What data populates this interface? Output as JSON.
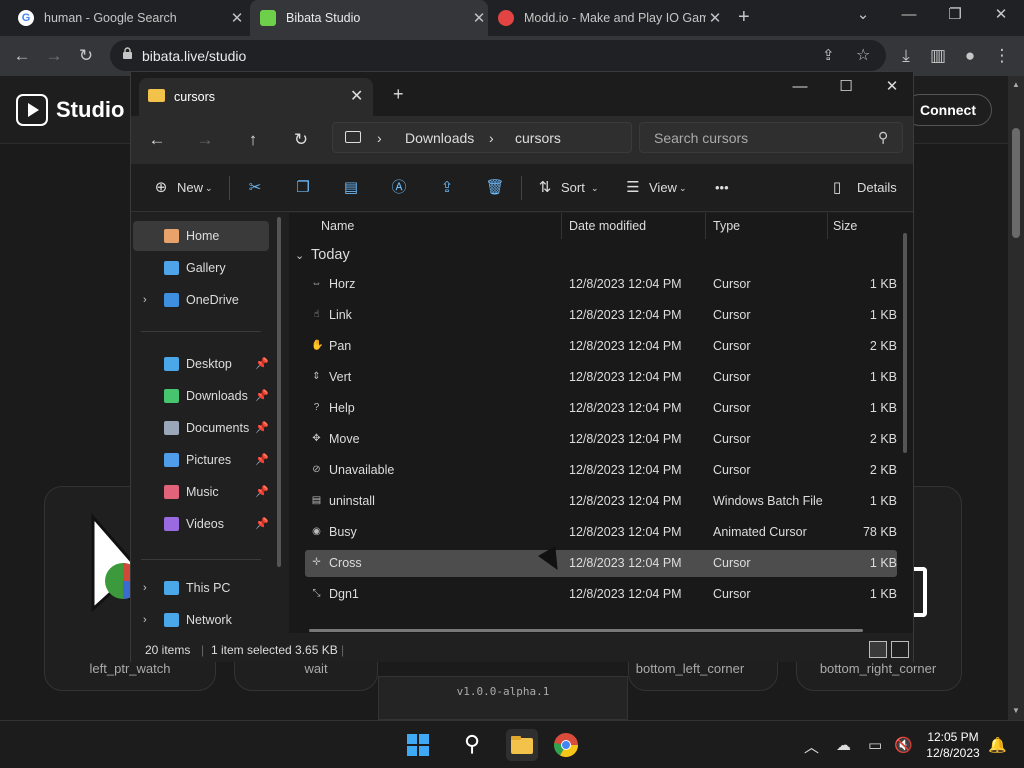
{
  "browser": {
    "tabs": [
      {
        "title": "human - Google Search",
        "favicon_color": "#ffffff"
      },
      {
        "title": "Bibata Studio",
        "favicon_color": "#6dcf4a"
      },
      {
        "title": "Modd.io - Make and Play IO Gam",
        "favicon_color": "#e24444"
      }
    ],
    "new_tab": "+",
    "url": "bibata.live/studio",
    "window_controls": {
      "min": "⌄",
      "minimize": "—",
      "restore": "❐",
      "close": "✕"
    }
  },
  "page": {
    "title": "Studio",
    "connect_label": "Connect",
    "cards": [
      "left_ptr_watch",
      "wait",
      "bottom_left_corner",
      "bottom_right_corner"
    ],
    "version": "v1.0.0-alpha.1"
  },
  "explorer": {
    "tab_title": "cursors",
    "address": [
      "Downloads",
      "cursors"
    ],
    "search_placeholder": "Search cursors",
    "commands": {
      "new": "New",
      "sort": "Sort",
      "view": "View",
      "more": "•••",
      "details": "Details"
    },
    "nav": [
      {
        "label": "Home",
        "icon_color": "#e8a26a",
        "selected": true
      },
      {
        "label": "Gallery",
        "icon_color": "#4fa3e8"
      },
      {
        "label": "OneDrive",
        "icon_color": "#3f8fe0",
        "expandable": true
      },
      {
        "label": "Desktop",
        "icon_color": "#4aa8e8",
        "pinned": true
      },
      {
        "label": "Downloads",
        "icon_color": "#46c46e",
        "pinned": true
      },
      {
        "label": "Documents",
        "icon_color": "#9aa7b8",
        "pinned": true
      },
      {
        "label": "Pictures",
        "icon_color": "#4f9de8",
        "pinned": true
      },
      {
        "label": "Music",
        "icon_color": "#e0637a",
        "pinned": true
      },
      {
        "label": "Videos",
        "icon_color": "#9b6ae0",
        "pinned": true
      },
      {
        "label": "This PC",
        "icon_color": "#4aa8e8",
        "expandable": true
      },
      {
        "label": "Network",
        "icon_color": "#4aa8e8",
        "expandable": true
      }
    ],
    "columns": [
      "Name",
      "Date modified",
      "Type",
      "Size"
    ],
    "group": "Today",
    "files": [
      {
        "name": "Horz",
        "date": "12/8/2023 12:04 PM",
        "type": "Cursor",
        "size": "1 KB",
        "icon": "⇔"
      },
      {
        "name": "Link",
        "date": "12/8/2023 12:04 PM",
        "type": "Cursor",
        "size": "1 KB",
        "icon": "☝"
      },
      {
        "name": "Pan",
        "date": "12/8/2023 12:04 PM",
        "type": "Cursor",
        "size": "2 KB",
        "icon": "✋"
      },
      {
        "name": "Vert",
        "date": "12/8/2023 12:04 PM",
        "type": "Cursor",
        "size": "1 KB",
        "icon": "⇕"
      },
      {
        "name": "Help",
        "date": "12/8/2023 12:04 PM",
        "type": "Cursor",
        "size": "1 KB",
        "icon": "?"
      },
      {
        "name": "Move",
        "date": "12/8/2023 12:04 PM",
        "type": "Cursor",
        "size": "2 KB",
        "icon": "✥"
      },
      {
        "name": "Unavailable",
        "date": "12/8/2023 12:04 PM",
        "type": "Cursor",
        "size": "2 KB",
        "icon": "⊘"
      },
      {
        "name": "uninstall",
        "date": "12/8/2023 12:04 PM",
        "type": "Windows Batch File",
        "size": "1 KB",
        "icon": "▤"
      },
      {
        "name": "Busy",
        "date": "12/8/2023 12:04 PM",
        "type": "Animated Cursor",
        "size": "78 KB",
        "icon": "◉"
      },
      {
        "name": "Cross",
        "date": "12/8/2023 12:04 PM",
        "type": "Cursor",
        "size": "1 KB",
        "icon": "✛",
        "selected": true
      },
      {
        "name": "Dgn1",
        "date": "12/8/2023 12:04 PM",
        "type": "Cursor",
        "size": "1 KB",
        "icon": "⤡"
      }
    ],
    "status": {
      "count": "20 items",
      "selection": "1 item selected  3.65 KB"
    }
  },
  "taskbar": {
    "time": "12:05 PM",
    "date": "12/8/2023"
  }
}
